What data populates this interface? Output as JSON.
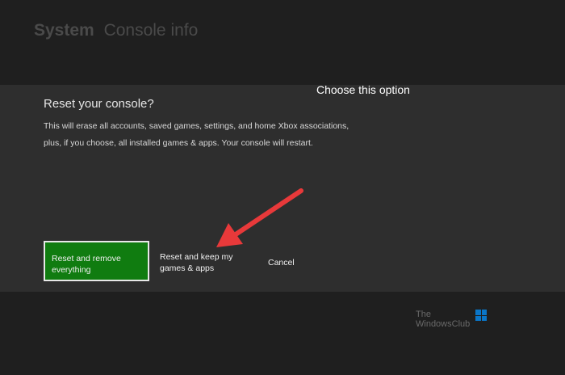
{
  "header": {
    "title_main": "System",
    "title_sub": "Console info"
  },
  "dialog": {
    "title": "Reset your console?",
    "body_line1": "This will erase all accounts, saved games, settings, and home Xbox associations,",
    "body_line2": "plus, if you choose, all installed games & apps. Your console will restart.",
    "buttons": {
      "reset_remove_line1": "Reset and remove",
      "reset_remove_line2": "everything",
      "reset_keep_line1": "Reset and keep my",
      "reset_keep_line2": "games & apps",
      "cancel": "Cancel"
    }
  },
  "annotation": {
    "text": "Choose this option"
  },
  "watermark": {
    "line1": "The",
    "line2": "WindowsClub"
  },
  "colors": {
    "accent_green": "#107c10",
    "arrow_red": "#e8393a"
  }
}
